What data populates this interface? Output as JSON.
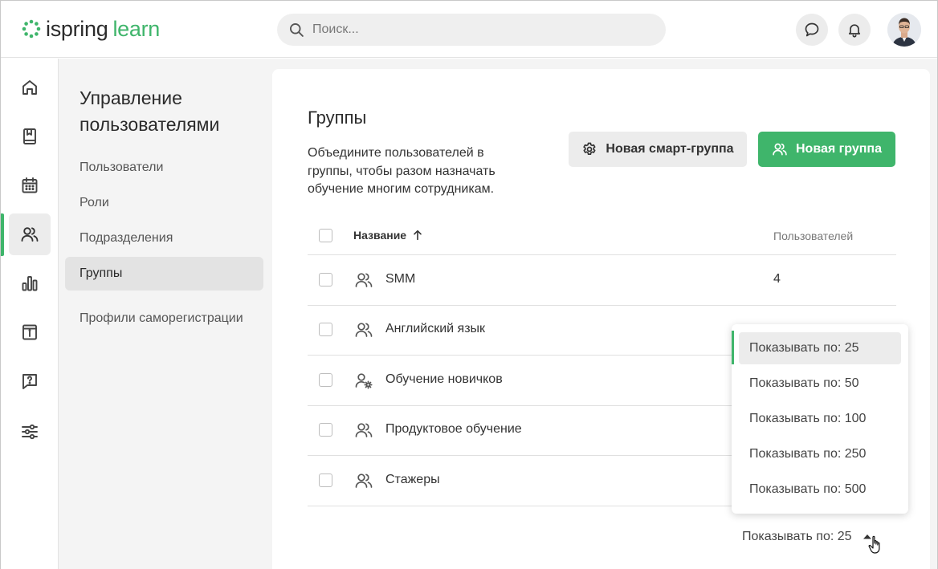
{
  "app": {
    "logo_part1": "ispring",
    "logo_part2": "learn",
    "brand_color": "#3fb56b"
  },
  "search": {
    "placeholder": "Поиск..."
  },
  "topbar": {
    "icons": [
      "chat-icon",
      "bell-icon"
    ]
  },
  "rail": {
    "items": [
      "home-icon",
      "book-icon",
      "calendar-icon",
      "users-icon",
      "chart-icon",
      "info-icon",
      "help-icon",
      "settings-sliders-icon"
    ],
    "active": "users-icon"
  },
  "subnav": {
    "title": "Управление пользователями",
    "items": [
      {
        "label": "Пользователи"
      },
      {
        "label": "Роли"
      },
      {
        "label": "Подразделения"
      },
      {
        "label": "Группы"
      },
      {
        "label": "Профили саморегистрации"
      }
    ],
    "active": "Группы"
  },
  "main": {
    "title": "Группы",
    "description": "Объедините пользователей в группы, чтобы разом назначать обучение многим сотрудникам.",
    "buttons": {
      "smart_group": "Новая смарт-группа",
      "new_group": "Новая группа"
    },
    "table": {
      "columns": [
        "Название",
        "Пользователей"
      ],
      "sort_column": "Название",
      "rows": [
        {
          "name": "SMM",
          "count": "4",
          "icon": "group-icon"
        },
        {
          "name": "Английский язык",
          "count": "",
          "icon": "group-icon"
        },
        {
          "name": "Обучение новичков",
          "count": "",
          "icon": "smart-group-icon"
        },
        {
          "name": "Продуктовое обучение",
          "count": "",
          "icon": "group-icon"
        },
        {
          "name": "Стажеры",
          "count": "",
          "icon": "group-icon"
        }
      ]
    },
    "pager": {
      "label": "Показывать по: 25"
    }
  },
  "dropdown": {
    "options": [
      "Показывать по: 25",
      "Показывать по: 50",
      "Показывать по: 100",
      "Показывать по: 250",
      "Показывать по: 500"
    ],
    "selected": "Показывать по: 25"
  }
}
